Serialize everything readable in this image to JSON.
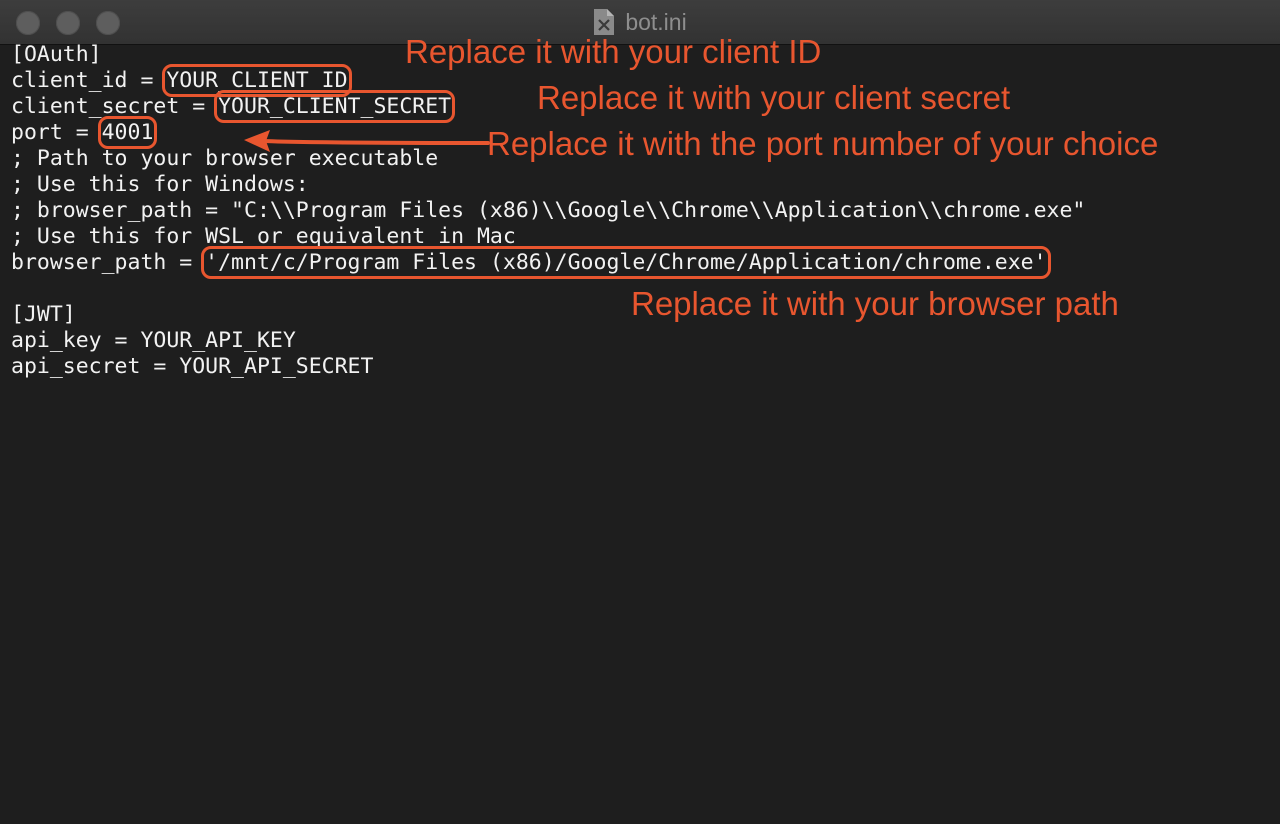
{
  "window": {
    "title": "bot.ini",
    "file_icon": "document-icon"
  },
  "editor": {
    "lines": [
      "[OAuth]",
      "client_id = ",
      "client_secret = ",
      "port = ",
      "; Path to your browser executable",
      "; Use this for Windows:",
      "; browser_path = \"C:\\\\Program Files (x86)\\\\Google\\\\Chrome\\\\Application\\\\chrome.exe\"",
      "; Use this for WSL or equivalent in Mac",
      "browser_path = ",
      "",
      "[JWT]",
      "api_key = YOUR_API_KEY",
      "api_secret = YOUR_API_SECRET"
    ],
    "values": {
      "client_id": "YOUR_CLIENT_ID",
      "client_secret": "YOUR_CLIENT_SECRET",
      "port": "4001",
      "browser_path": "'/mnt/c/Program Files (x86)/Google/Chrome/Application/chrome.exe'"
    }
  },
  "annotations": {
    "client_id": "Replace it with your client ID",
    "client_secret": "Replace it with your client secret",
    "port": "Replace it with the port number of your choice",
    "browser_path": "Replace it with your browser path"
  },
  "colors": {
    "annotation": "#e8562f",
    "background": "#1e1e1e",
    "text": "#f2f2f2"
  }
}
